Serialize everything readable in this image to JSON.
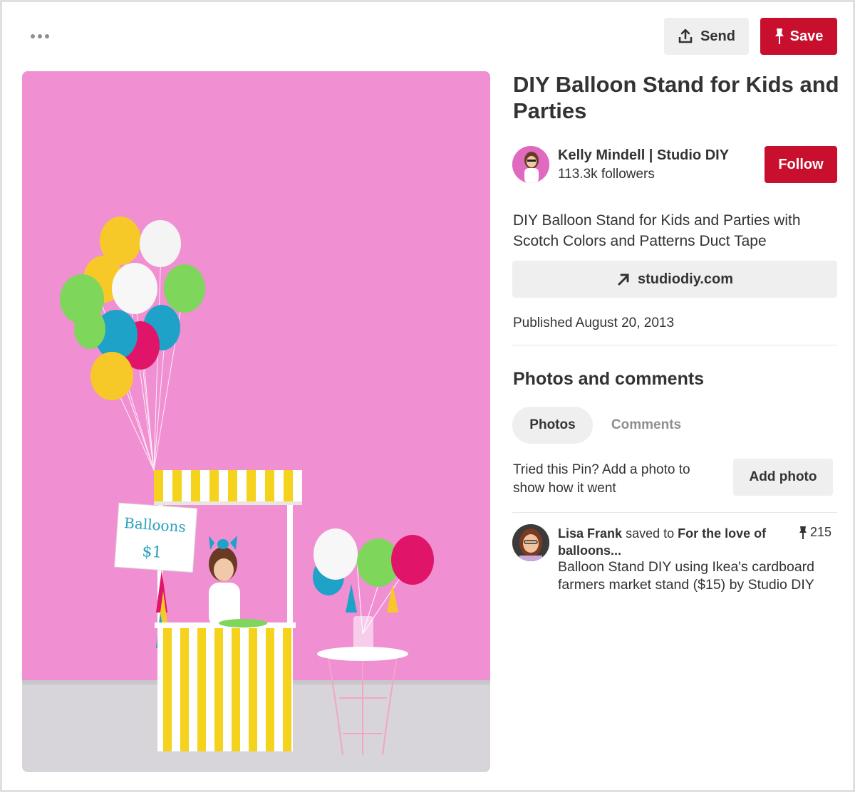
{
  "toolbar": {
    "more_icon": "more-horizontal-icon",
    "send_label": "Send",
    "send_icon": "upload-share-icon",
    "save_label": "Save",
    "save_icon": "pin-icon"
  },
  "pin": {
    "title": "DIY Balloon Stand for Kids and Parties",
    "description": "DIY Balloon Stand for Kids and Parties with Scotch Colors and Patterns Duct Tape",
    "link_label": "studiodiy.com",
    "link_icon": "arrow-up-right-icon",
    "published": "Published August 20, 2013",
    "image_sign_line1": "Balloons",
    "image_sign_line2": "$1"
  },
  "author": {
    "name": "Kelly Mindell | Studio DIY",
    "followers": "113.3k followers",
    "follow_label": "Follow"
  },
  "photos_comments": {
    "title": "Photos and comments",
    "tabs": [
      {
        "label": "Photos",
        "active": true
      },
      {
        "label": "Comments",
        "active": false
      }
    ],
    "prompt": "Tried this Pin? Add a photo to show how it went",
    "add_photo_label": "Add photo"
  },
  "activity": {
    "user": "Lisa Frank",
    "saved_to": "saved to",
    "board": "For the love of balloons...",
    "save_count": "215",
    "text": "Balloon Stand DIY using Ikea's cardboard farmers market stand ($15) by Studio DIY"
  },
  "colors": {
    "brand_red": "#c8102e",
    "button_gray": "#efefef",
    "wall_pink": "#f08fd2"
  }
}
